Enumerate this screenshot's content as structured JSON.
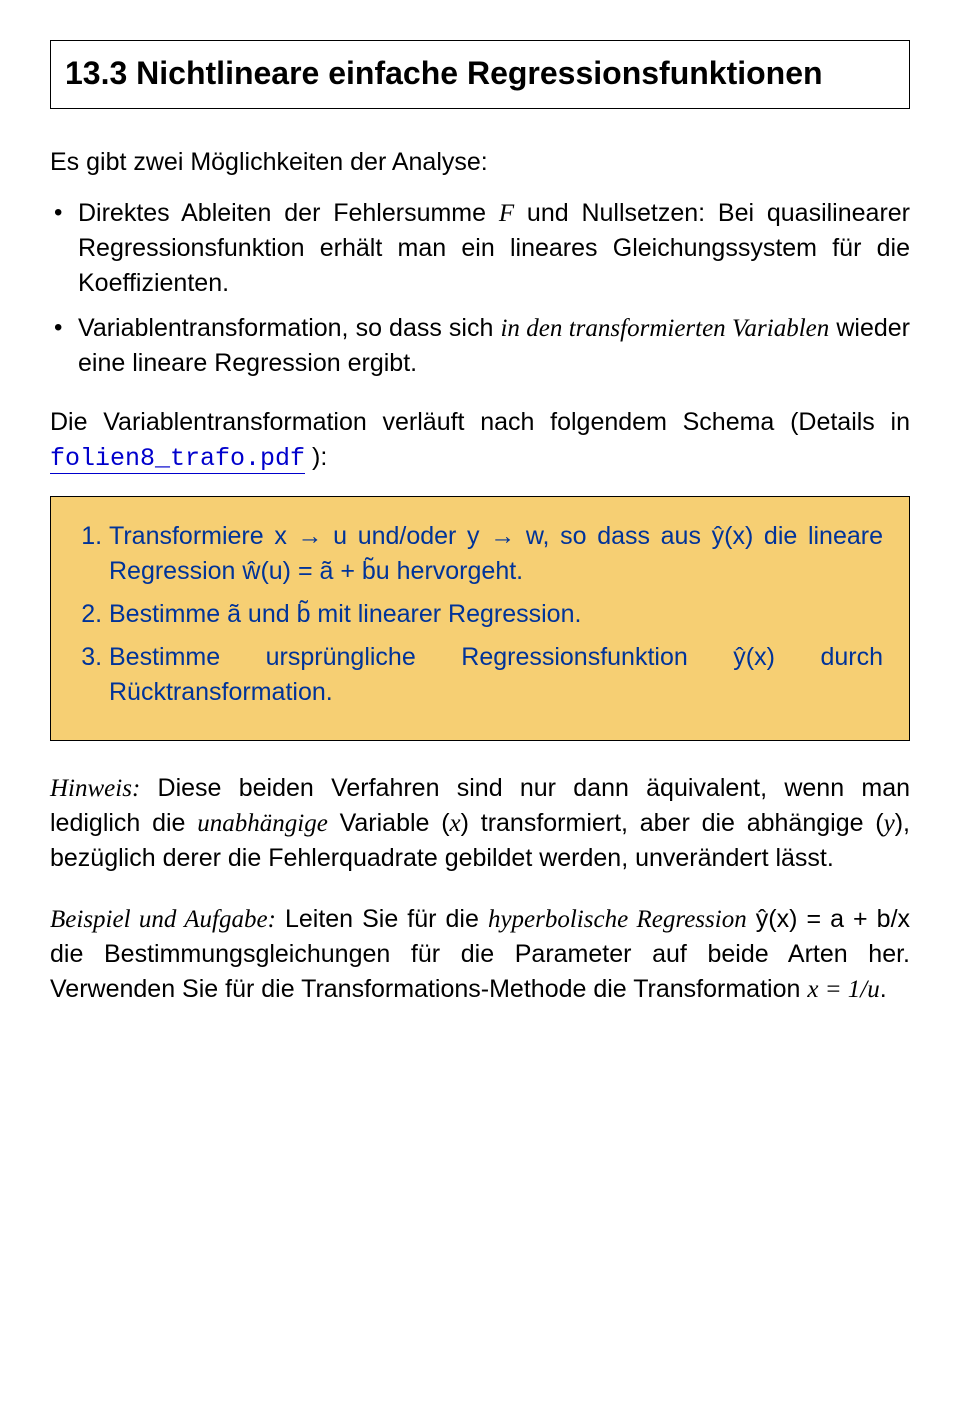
{
  "title": "13.3 Nichtlineare einfache Regressionsfunktionen",
  "intro": "Es gibt zwei Möglichkeiten der Analyse:",
  "bullets": {
    "b1_a": "Direktes Ableiten der Fehlersumme ",
    "b1_F": "F",
    "b1_b": " und Nullsetzen: Bei quasilinearer Regressionsfunktion erhält man ein lineares Gleichungssystem für die Koeffizienten.",
    "b2_a": "Variablentransformation, so dass sich ",
    "b2_ital": "in den transformierten Variablen",
    "b2_b": " wieder eine lineare Regression ergibt."
  },
  "schema_intro_a": "Die Variablentransformation verläuft nach folgendem Schema (Details in ",
  "schema_link": "folien8_trafo.pdf",
  "schema_intro_b": " ):",
  "steps": {
    "s1": "Transformiere x → u und/oder y → w, so dass aus ŷ(x) die lineare Regression ŵ(u) = ã + b̃u hervorgeht.",
    "s2": "Bestimme ã und b̃ mit linearer Regression.",
    "s3": "Bestimme ursprüngliche Regressionsfunktion ŷ(x) durch Rücktransformation."
  },
  "hinweis_label": "Hinweis:",
  "hinweis_a": " Diese beiden Verfahren sind nur dann äquivalent, wenn man lediglich die ",
  "hinweis_ital1": "unabhängige",
  "hinweis_b": " Variable (",
  "hinweis_x": "x",
  "hinweis_c": ") transformiert, aber die abhängige (",
  "hinweis_y": "y",
  "hinweis_d": "), bezüglich derer die Fehlerquadrate gebildet werden, unverändert lässt.",
  "beispiel_label": "Beispiel und Aufgabe:",
  "beispiel_a": " Leiten Sie für die ",
  "beispiel_ital": "hyperbolische Regression",
  "beispiel_b": " ŷ(x) = a + b/x die Bestimmungsgleichungen für die Parameter auf beide Arten her. Verwenden Sie für die Transformations-Methode die Transformation ",
  "beispiel_math": "x = 1/u",
  "beispiel_c": "."
}
